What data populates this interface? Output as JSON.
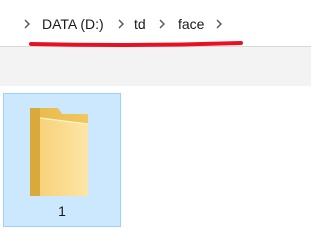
{
  "breadcrumb": {
    "items": [
      {
        "label": "DATA (D:)"
      },
      {
        "label": "td"
      },
      {
        "label": "face"
      }
    ]
  },
  "annotation": {
    "color": "#e81123"
  },
  "folders": [
    {
      "name": "1",
      "selected": true,
      "icon": "folder-icon"
    }
  ]
}
